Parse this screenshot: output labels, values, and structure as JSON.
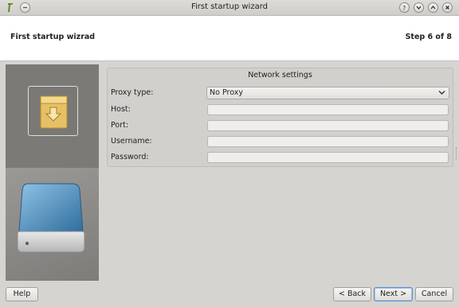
{
  "window": {
    "title": "First startup wizard"
  },
  "header": {
    "title": "First startup wizrad",
    "step": "Step 6 of 8"
  },
  "section": {
    "title": "Network settings"
  },
  "form": {
    "proxy_type_label": "Proxy type:",
    "proxy_type_value": "No Proxy",
    "host_label": "Host:",
    "host_value": "",
    "port_label": "Port:",
    "port_value": "",
    "username_label": "Username:",
    "username_value": "",
    "password_label": "Password:",
    "password_value": ""
  },
  "buttons": {
    "help": "Help",
    "back": "< Back",
    "next": "Next >",
    "cancel": "Cancel"
  },
  "icons": [
    "app-icon",
    "window-menu-icon",
    "help-icon",
    "minimize-icon",
    "maximize-icon",
    "close-icon",
    "package-install-icon",
    "hard-drive-icon",
    "chevron-down-icon"
  ]
}
